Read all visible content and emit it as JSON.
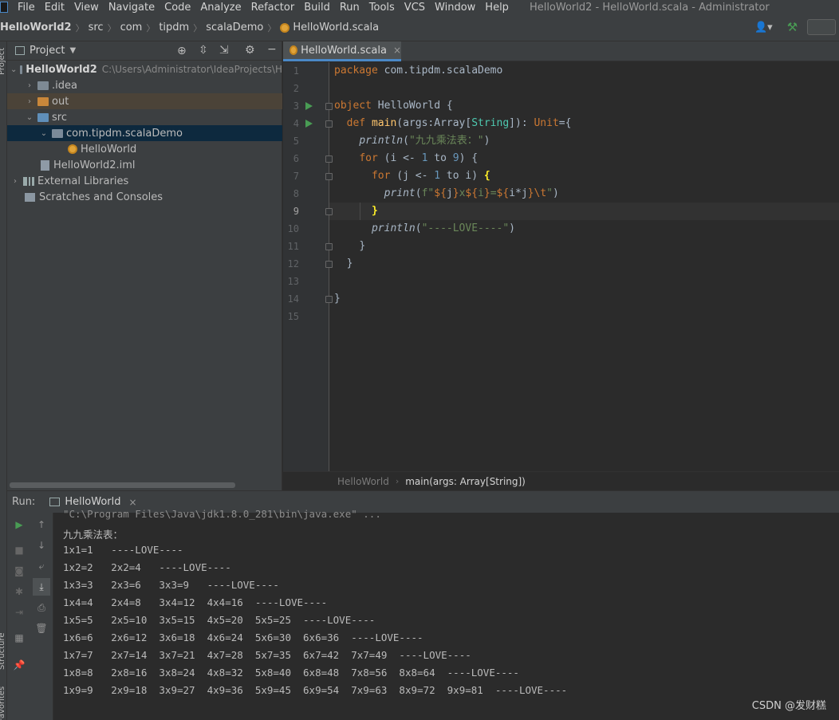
{
  "menubar": {
    "items": [
      "File",
      "Edit",
      "View",
      "Navigate",
      "Code",
      "Analyze",
      "Refactor",
      "Build",
      "Run",
      "Tools",
      "VCS",
      "Window",
      "Help"
    ],
    "window_title": "HelloWorld2 - HelloWorld.scala - Administrator"
  },
  "navbar": {
    "crumbs": [
      "HelloWorld2",
      "src",
      "com",
      "tipdm",
      "scalaDemo",
      "HelloWorld.scala"
    ]
  },
  "sidestrip": {
    "project": "Project",
    "structure": "Structure",
    "favorites": "Favorites"
  },
  "project_panel": {
    "title": "Project",
    "tree": [
      {
        "label": "HelloWorld2",
        "path": "C:\\Users\\Administrator\\IdeaProjects\\H",
        "icon": "module-folder-icon",
        "expanded": true
      },
      {
        "label": ".idea",
        "icon": "folder-icon",
        "expanded": false
      },
      {
        "label": "out",
        "icon": "excluded-folder-icon",
        "expanded": false
      },
      {
        "label": "src",
        "icon": "source-folder-icon",
        "expanded": true
      },
      {
        "label": "com.tipdm.scalaDemo",
        "icon": "package-icon",
        "expanded": true
      },
      {
        "label": "HelloWorld",
        "icon": "scala-object-icon"
      },
      {
        "label": "HelloWorld2.iml",
        "icon": "iml-file-icon"
      },
      {
        "label": "External Libraries",
        "icon": "library-icon",
        "expanded": false
      },
      {
        "label": "Scratches and Consoles",
        "icon": "scratches-icon"
      }
    ]
  },
  "editor": {
    "tab_label": "HelloWorld.scala",
    "line_numbers": [
      "1",
      "2",
      "3",
      "4",
      "5",
      "6",
      "7",
      "8",
      "9",
      "10",
      "11",
      "12",
      "13",
      "14",
      "15"
    ],
    "current_line": "9",
    "lines": {
      "l1_kw": "package",
      "l1_rest": " com.tipdm.scalaDemo",
      "l3_kw": "object",
      "l3_rest": " HelloWorld {",
      "l4_kw": "def",
      "l4_fn": "main",
      "l4_a": "(args:Array[",
      "l4_ty": "String",
      "l4_b": "]): ",
      "l4_unit": "Unit",
      "l4_c": "={",
      "l5_fn": "println",
      "l5_a": "(",
      "l5_str": "\"九九乘法表：\"",
      "l5_b": ")",
      "l6_kw": "for",
      "l6_a": " (i <- ",
      "l6_n1": "1",
      "l6_to": " to ",
      "l6_n2": "9",
      "l6_b": ") {",
      "l7_kw": "for",
      "l7_a": " (j <- ",
      "l7_n1": "1",
      "l7_to": " to ",
      "l7_b": "i) ",
      "l7_brace": "{",
      "l8_fn": "print",
      "l8_a": "(",
      "l8_s1": "f\"",
      "l8_i1": "${",
      "l8_j": "j",
      "l8_i2": "}",
      "l8_s2": "x",
      "l8_i3": "${",
      "l8_i": "i",
      "l8_i4": "}",
      "l8_s3": "=",
      "l8_i5": "${",
      "l8_ij": "i*j",
      "l8_i6": "}",
      "l8_esc": "\\t",
      "l8_s4": "\"",
      "l8_b": ")",
      "l9_brace": "}",
      "l10_fn": "println",
      "l10_a": "(",
      "l10_str": "\"----LOVE----\"",
      "l10_b": ")",
      "l11": "}",
      "l12": "}",
      "l14": "}"
    },
    "breadcrumb": [
      "HelloWorld",
      "main(args: Array[String])"
    ]
  },
  "run_panel": {
    "label": "Run:",
    "tab_label": "HelloWorld",
    "command": "\"C:\\Program Files\\Java\\jdk1.8.0_281\\bin\\java.exe\" ...",
    "output": [
      "九九乘法表：",
      "1x1=1   ----LOVE----",
      "1x2=2   2x2=4   ----LOVE----",
      "1x3=3   2x3=6   3x3=9   ----LOVE----",
      "1x4=4   2x4=8   3x4=12  4x4=16  ----LOVE----",
      "1x5=5   2x5=10  3x5=15  4x5=20  5x5=25  ----LOVE----",
      "1x6=6   2x6=12  3x6=18  4x6=24  5x6=30  6x6=36  ----LOVE----",
      "1x7=7   2x7=14  3x7=21  4x7=28  5x7=35  6x7=42  7x7=49  ----LOVE----",
      "1x8=8   2x8=16  3x8=24  4x8=32  5x8=40  6x8=48  7x8=56  8x8=64  ----LOVE----",
      "1x9=9   2x9=18  3x9=27  4x9=36  5x9=45  6x9=54  7x9=63  8x9=72  9x9=81  ----LOVE----"
    ]
  },
  "watermark": "CSDN @发财糕",
  "colors": {
    "background": "#2b2b2b",
    "panel": "#3c3f41",
    "keyword": "#cc7832",
    "string": "#6a8759",
    "number": "#6897bb",
    "function": "#ffc66d",
    "accent": "#4a88c7",
    "run_green": "#499c54"
  }
}
